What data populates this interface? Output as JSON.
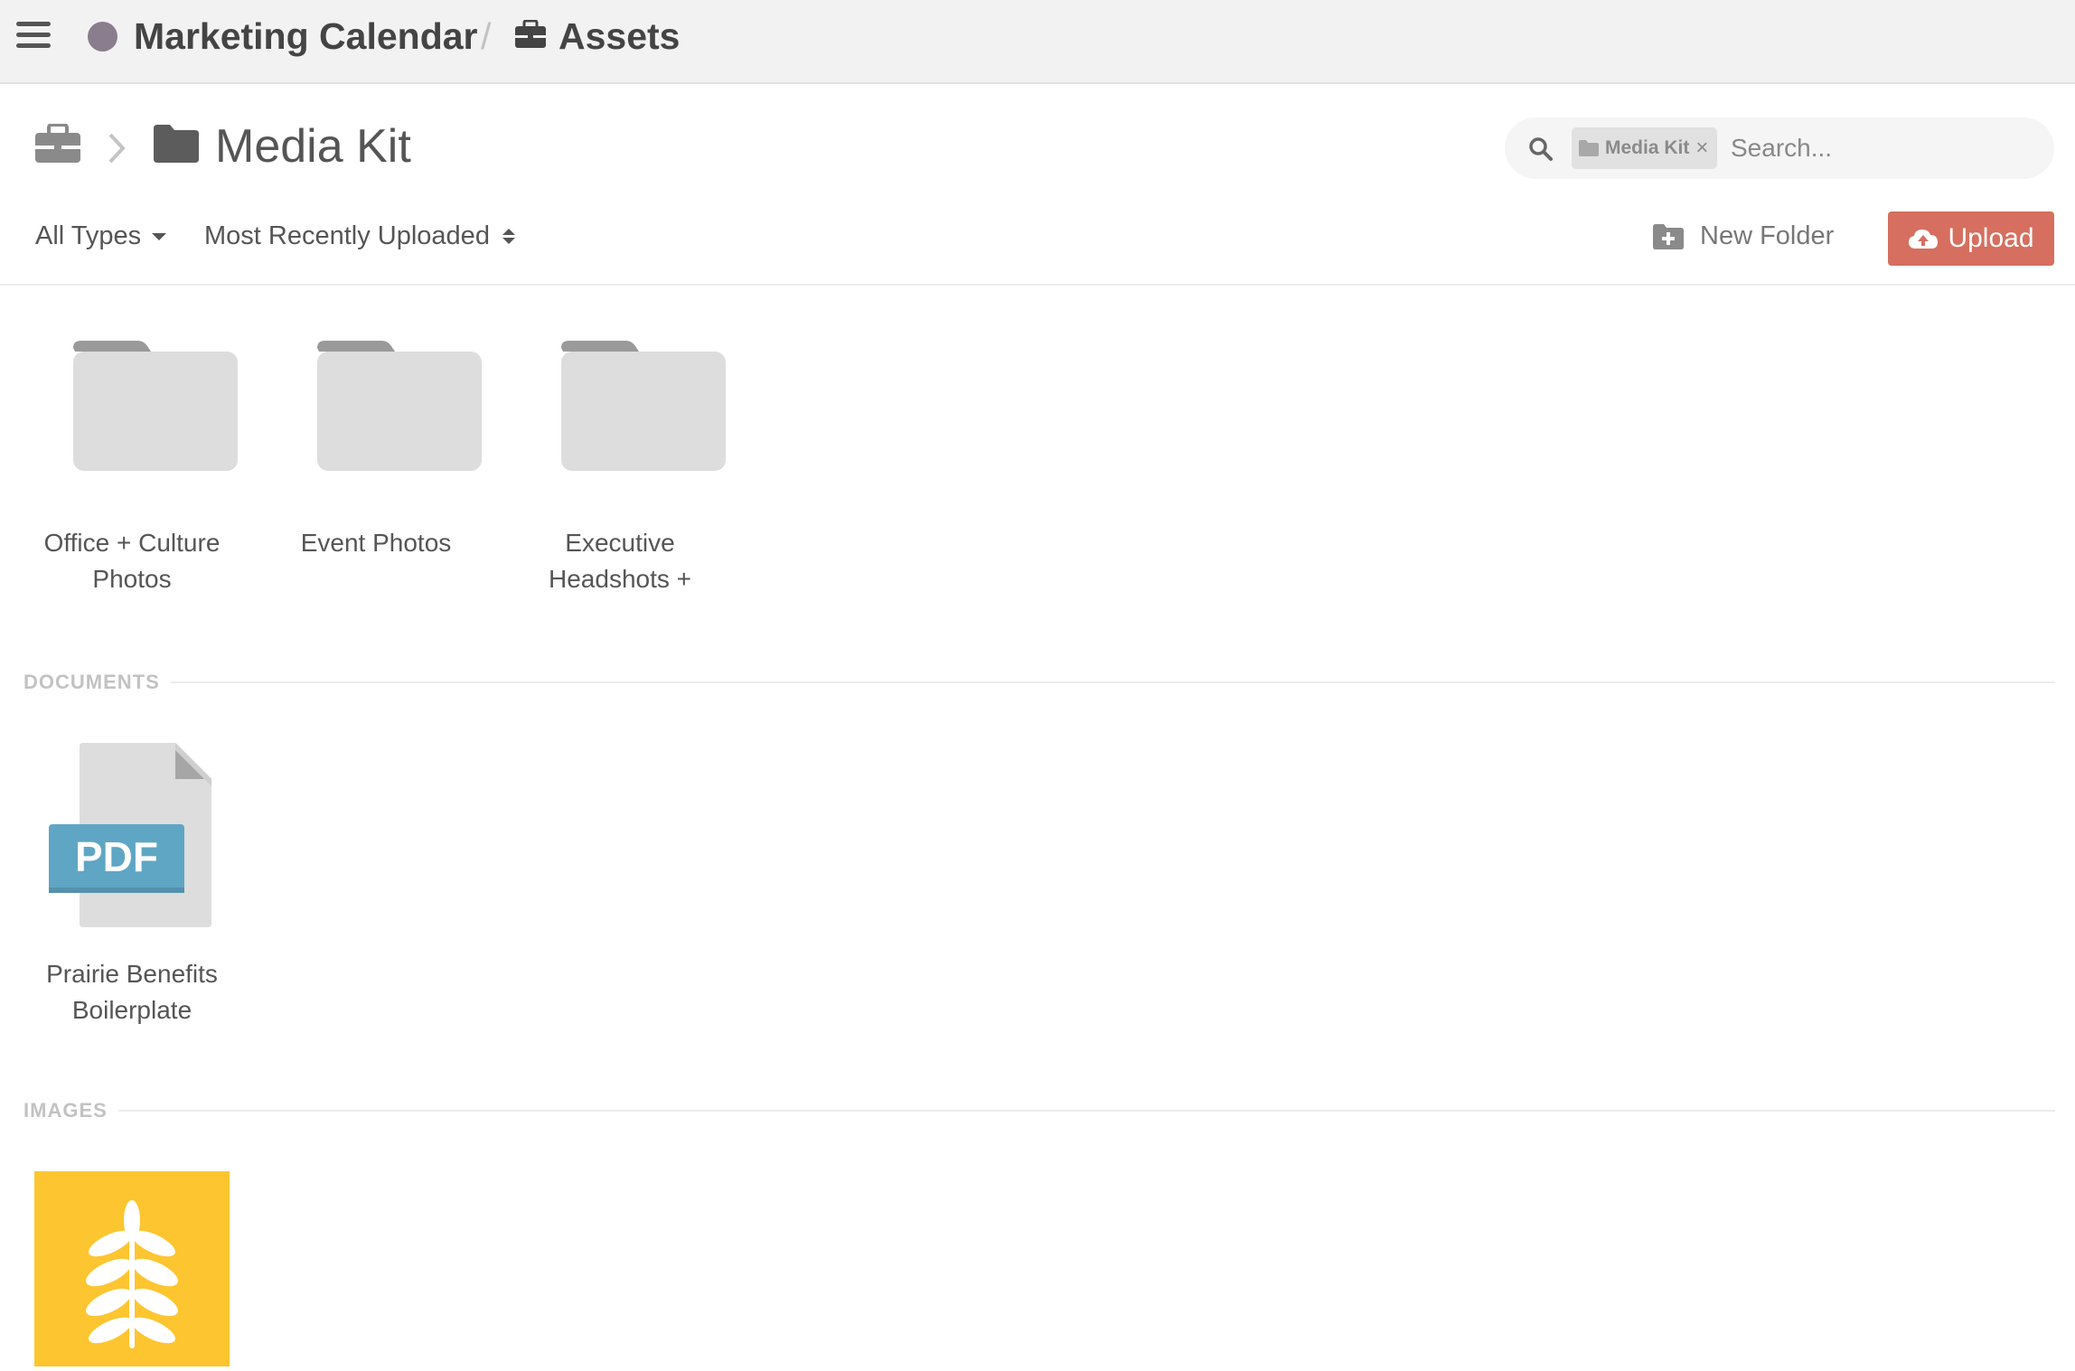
{
  "topbar": {
    "title": "Marketing Calendar",
    "separator": "/",
    "section": "Assets",
    "icons": [
      "hamburger-menu-icon",
      "workspace-dot",
      "briefcase-icon"
    ]
  },
  "header": {
    "title": "Media Kit",
    "icons": [
      "briefcase-icon",
      "chevron-right-icon",
      "folder-icon"
    ]
  },
  "search": {
    "chip_label": "Media Kit",
    "chip_close": "×",
    "placeholder": "Search..."
  },
  "filters": {
    "types_label": "All Types",
    "sort_label": "Most Recently Uploaded"
  },
  "actions": {
    "new_folder_label": "New Folder",
    "upload_label": "Upload"
  },
  "folders": [
    {
      "name_line1": "Office + Culture",
      "name_line2": "Photos"
    },
    {
      "name_line1": "Event Photos",
      "name_line2": ""
    },
    {
      "name_line1": "Executive",
      "name_line2": "Headshots +"
    }
  ],
  "documents": {
    "section_title": "DOCUMENTS",
    "items": [
      {
        "badge": "PDF",
        "name_line1": "Prairie Benefits",
        "name_line2": "Boilerplate"
      }
    ]
  },
  "images": {
    "section_title": "IMAGES",
    "items": [
      {
        "icon": "wheat-icon",
        "background": "#fdc530"
      }
    ]
  },
  "colors": {
    "topbar_bg": "#f2f2f2",
    "upload_button": "#d66f5f",
    "pdf_badge": "#5fa6c4",
    "image_tile": "#fdc530",
    "workspace_dot": "#8a7d8e"
  }
}
